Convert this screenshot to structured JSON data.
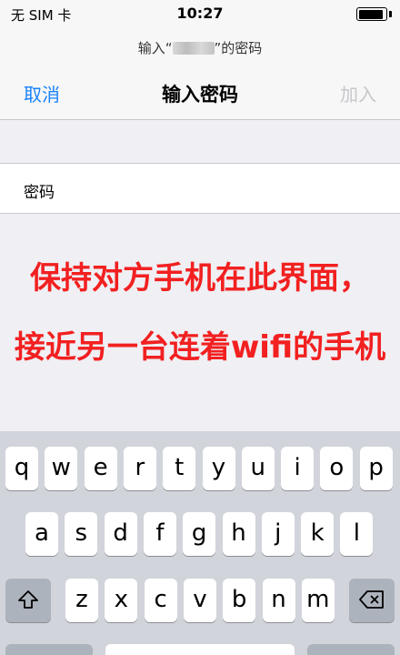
{
  "status_bar": {
    "carrier": "无 SIM 卡",
    "time": "10:27",
    "battery_level": 0.9
  },
  "header": {
    "prompt_prefix": "输入“",
    "prompt_suffix": "”的密码",
    "cancel_label": "取消",
    "title": "输入密码",
    "join_label": "加入"
  },
  "form": {
    "password_label": "密码",
    "password_value": ""
  },
  "annotation": {
    "line1": "保持对方手机在此界面，",
    "line2": "接近另一台连着wifi的手机"
  },
  "keyboard": {
    "row1": [
      "q",
      "w",
      "e",
      "r",
      "t",
      "y",
      "u",
      "i",
      "o",
      "p"
    ],
    "row2": [
      "a",
      "s",
      "d",
      "f",
      "g",
      "h",
      "j",
      "k",
      "l"
    ],
    "row3": [
      "z",
      "x",
      "c",
      "v",
      "b",
      "n",
      "m"
    ],
    "shift_icon": "shift-icon",
    "delete_icon": "delete-icon"
  }
}
